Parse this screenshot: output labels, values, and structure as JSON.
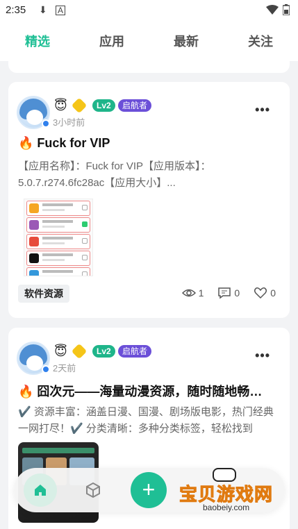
{
  "status_bar": {
    "time": "2:35",
    "icons": [
      "download-icon",
      "font-icon",
      "wifi-icon",
      "battery-icon"
    ]
  },
  "tabs": [
    {
      "label": "精选",
      "active": true
    },
    {
      "label": "应用",
      "active": false
    },
    {
      "label": "最新",
      "active": false
    },
    {
      "label": "关注",
      "active": false
    }
  ],
  "colors": {
    "accent": "#1fbf95",
    "lv_badge": "#1fb58a",
    "nav_tag": "#6b4fd8"
  },
  "posts": [
    {
      "level": "Lv2",
      "tag": "启航者",
      "time": "3小时前",
      "title": "🔥 Fuck for VIP",
      "desc": "【应用名称】：Fuck for VIP【应用版本】：5.0.7.r274.6fc28ac【应用大小】...",
      "category": "软件资源",
      "views": "1",
      "comments": "0",
      "likes": "0"
    },
    {
      "level": "Lv2",
      "tag": "启航者",
      "time": "2天前",
      "title": "🔥 囧次元——海量动漫资源，随时随地畅…",
      "desc": "✔️ 资源丰富：涵盖日漫、国漫、剧场版电影，热门经典一网打尽！✔️ 分类清晰：多种分类标签，轻松找到"
    }
  ],
  "bottom_nav": {
    "items": [
      "home-icon",
      "cube-icon"
    ],
    "fab": "+"
  },
  "watermark": {
    "text": "宝贝游戏网",
    "url": "baobeiy.com"
  }
}
